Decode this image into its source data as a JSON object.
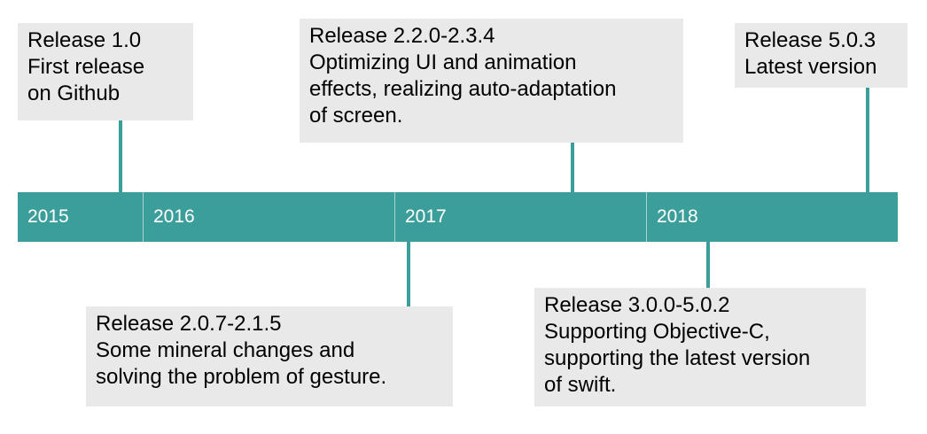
{
  "timeline": {
    "colors": {
      "bar": "#3c9e9b",
      "box": "#e9e9e9",
      "year_text": "#ffffff"
    },
    "years": [
      "2015",
      "2016",
      "2017",
      "2018"
    ],
    "releases": [
      {
        "title": "Release 1.0",
        "lines": [
          "First release",
          "on Github"
        ]
      },
      {
        "title": "Release 2.2.0-2.3.4",
        "lines": [
          "Optimizing UI and animation",
          "effects, realizing auto-adaptation",
          "of screen."
        ]
      },
      {
        "title": "Release 5.0.3",
        "lines": [
          "Latest version"
        ]
      },
      {
        "title": "Release 2.0.7-2.1.5",
        "lines": [
          "Some mineral changes and",
          "solving the problem of gesture."
        ]
      },
      {
        "title": "Release 3.0.0-5.0.2",
        "lines": [
          "Supporting Objective-C,",
          "supporting the latest version",
          "of swift."
        ]
      }
    ]
  }
}
